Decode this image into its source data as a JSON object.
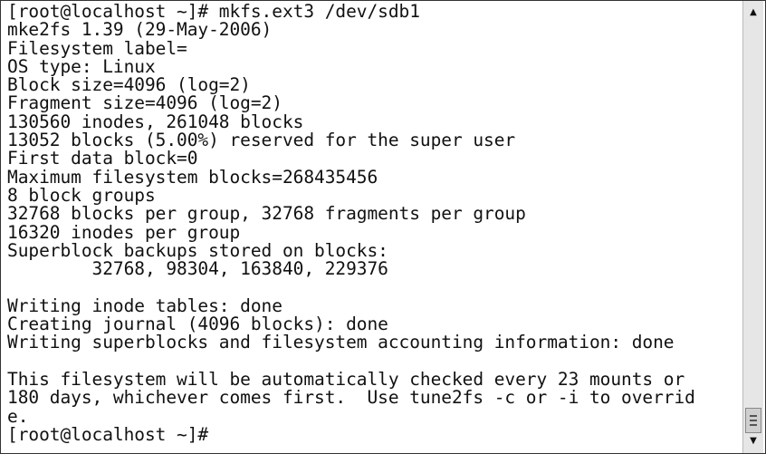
{
  "terminal": {
    "lines": [
      "[root@localhost ~]# mkfs.ext3 /dev/sdb1",
      "mke2fs 1.39 (29-May-2006)",
      "Filesystem label=",
      "OS type: Linux",
      "Block size=4096 (log=2)",
      "Fragment size=4096 (log=2)",
      "130560 inodes, 261048 blocks",
      "13052 blocks (5.00%) reserved for the super user",
      "First data block=0",
      "Maximum filesystem blocks=268435456",
      "8 block groups",
      "32768 blocks per group, 32768 fragments per group",
      "16320 inodes per group",
      "Superblock backups stored on blocks:",
      "        32768, 98304, 163840, 229376",
      "",
      "Writing inode tables: done",
      "Creating journal (4096 blocks): done",
      "Writing superblocks and filesystem accounting information: done",
      "",
      "This filesystem will be automatically checked every 23 mounts or",
      "180 days, whichever comes first.  Use tune2fs -c or -i to overrid",
      "e.",
      "[root@localhost ~]#"
    ]
  },
  "scrollbar": {
    "up_icon": "arrow-up-icon",
    "down_icon": "arrow-down-icon",
    "position_percent": 100
  }
}
